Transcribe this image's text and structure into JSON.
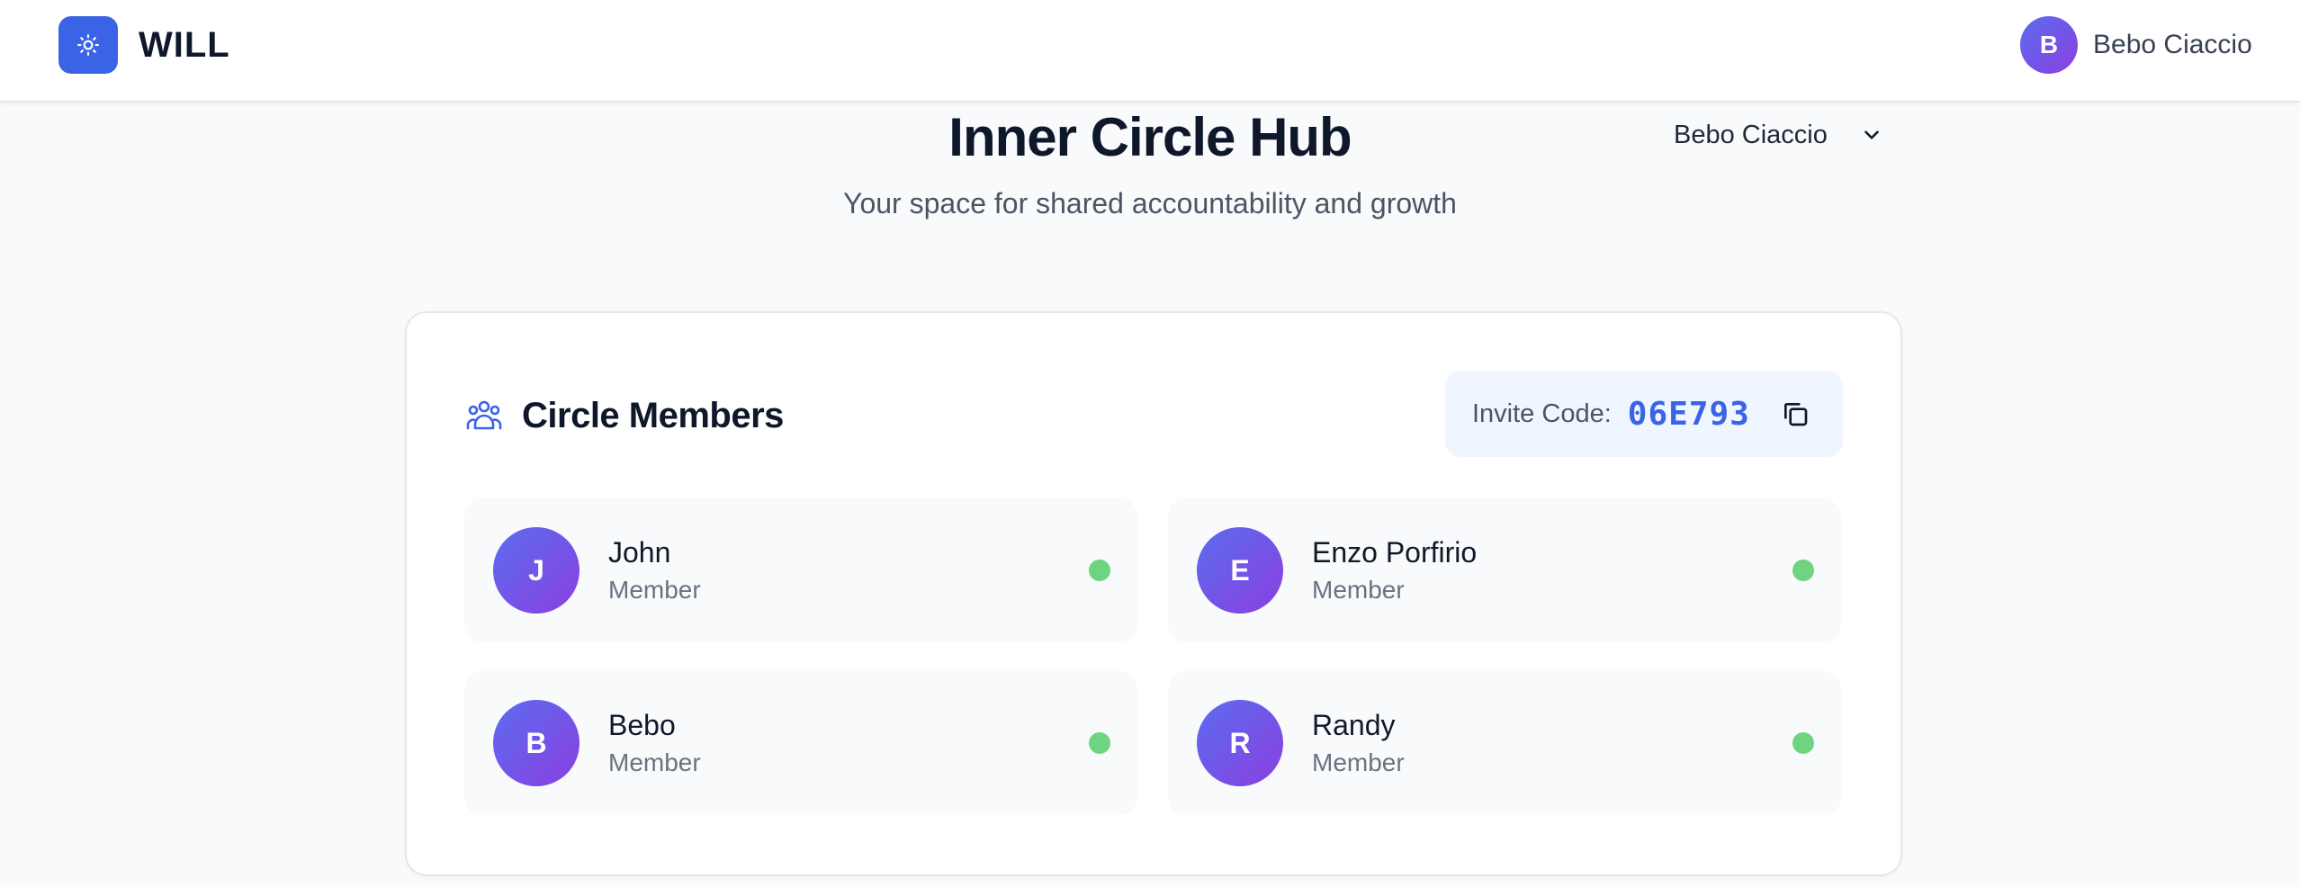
{
  "app": {
    "name": "WILL"
  },
  "header": {
    "user_initial": "B",
    "user_name": "Bebo Ciaccio"
  },
  "hub": {
    "title": "Inner Circle Hub",
    "subtitle": "Your space for shared accountability and growth",
    "selected_user": "Bebo Ciaccio"
  },
  "circle": {
    "section_title": "Circle Members",
    "invite_label": "Invite Code:",
    "invite_code": "06E793",
    "members": [
      {
        "initial": "J",
        "name": "John",
        "role": "Member",
        "status": "online"
      },
      {
        "initial": "E",
        "name": "Enzo Porfirio",
        "role": "Member",
        "status": "online"
      },
      {
        "initial": "B",
        "name": "Bebo",
        "role": "Member",
        "status": "online"
      },
      {
        "initial": "R",
        "name": "Randy",
        "role": "Member",
        "status": "online"
      }
    ]
  },
  "colors": {
    "accent": "#3b63e6",
    "avatar_gradient_start": "#5b6cf0",
    "avatar_gradient_end": "#8b3fe0",
    "online": "#6ed47f",
    "background": "#f8fafc"
  },
  "icons": {
    "logo": "sun-icon",
    "section": "users-group-icon",
    "copy": "copy-icon",
    "dropdown": "chevron-down-icon"
  }
}
